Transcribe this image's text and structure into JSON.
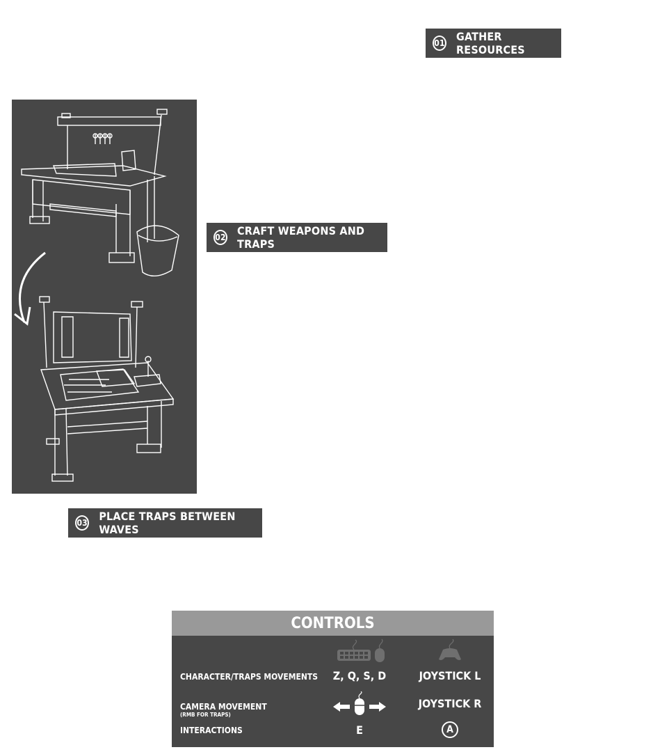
{
  "steps": [
    {
      "number": "01",
      "label": "GATHER RESOURCES"
    },
    {
      "number": "02",
      "label": "CRAFT WEAPONS AND TRAPS"
    },
    {
      "number": "03",
      "label": "PLACE TRAPS BETWEEN WAVES"
    }
  ],
  "controls": {
    "title": "CONTROLS",
    "input_icons": [
      "keyboard-mouse-icon",
      "gamepad-icon"
    ],
    "rows": [
      {
        "action": "CHARACTER/TRAPS MOVEMENTS",
        "keyboard": "Z, Q, S, D",
        "gamepad": "JOYSTICK L"
      },
      {
        "action": "CAMERA MOVEMENT",
        "note": "(RMB FOR TRAPS)",
        "keyboard_icon": "mouse-drag-icon",
        "gamepad": "JOYSTICK R"
      },
      {
        "action": "INTERACTIONS",
        "keyboard": "E",
        "gamepad": "A"
      }
    ]
  },
  "colors": {
    "panel": "#474747",
    "header": "#999999",
    "text": "#ffffff"
  }
}
